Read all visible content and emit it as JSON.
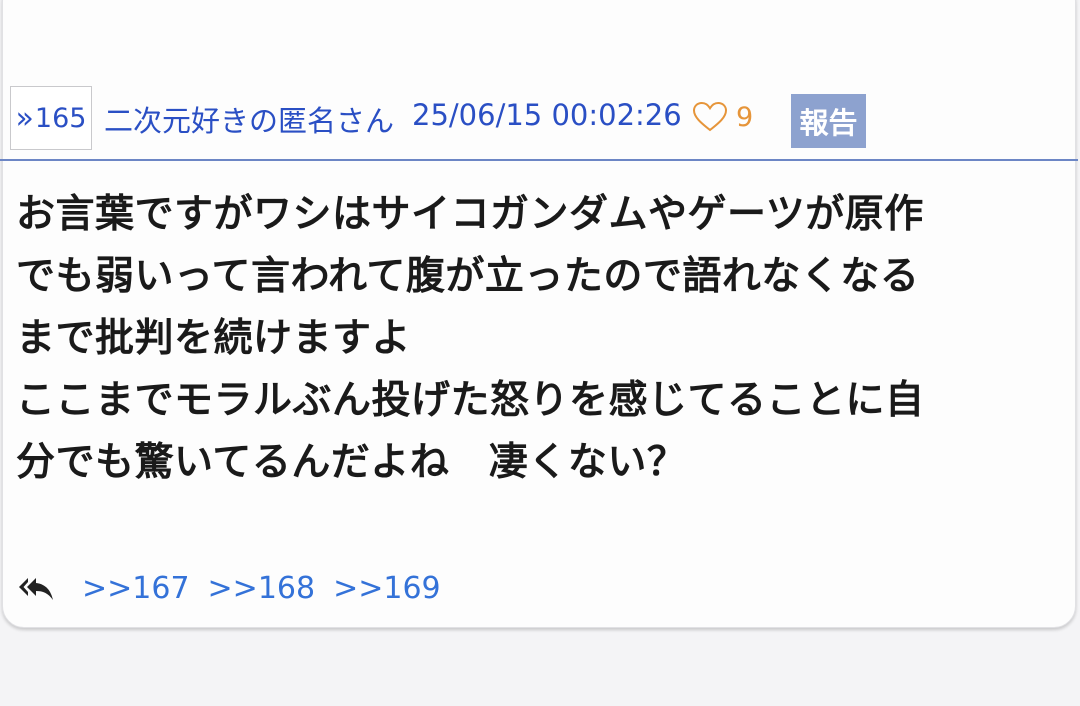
{
  "post": {
    "number": "165",
    "author": "二次元好きの匿名さん",
    "timestamp": "25/06/15 00:02:26",
    "like_count": "9",
    "report_label": "報告",
    "body": "お言葉ですがワシはサイコガンダムやゲーツが原作\nでも弱いって言われて腹が立ったので語れなくなる\nまで批判を続けますよ\nここまでモラルぶん投げた怒りを感じてることに自\n分でも驚いてるんだよね　凄くない？",
    "replies": [
      ">>167",
      ">>168",
      ">>169"
    ]
  },
  "colors": {
    "link_blue": "#2a4fc4",
    "reply_blue": "#3472d8",
    "like_orange": "#e6953a",
    "report_bg": "#8da2cf",
    "divider": "#6c86c5"
  },
  "icons": {
    "res_marker": "double-chevron-right-icon",
    "like": "heart-outline-icon",
    "reply": "reply-all-icon"
  }
}
